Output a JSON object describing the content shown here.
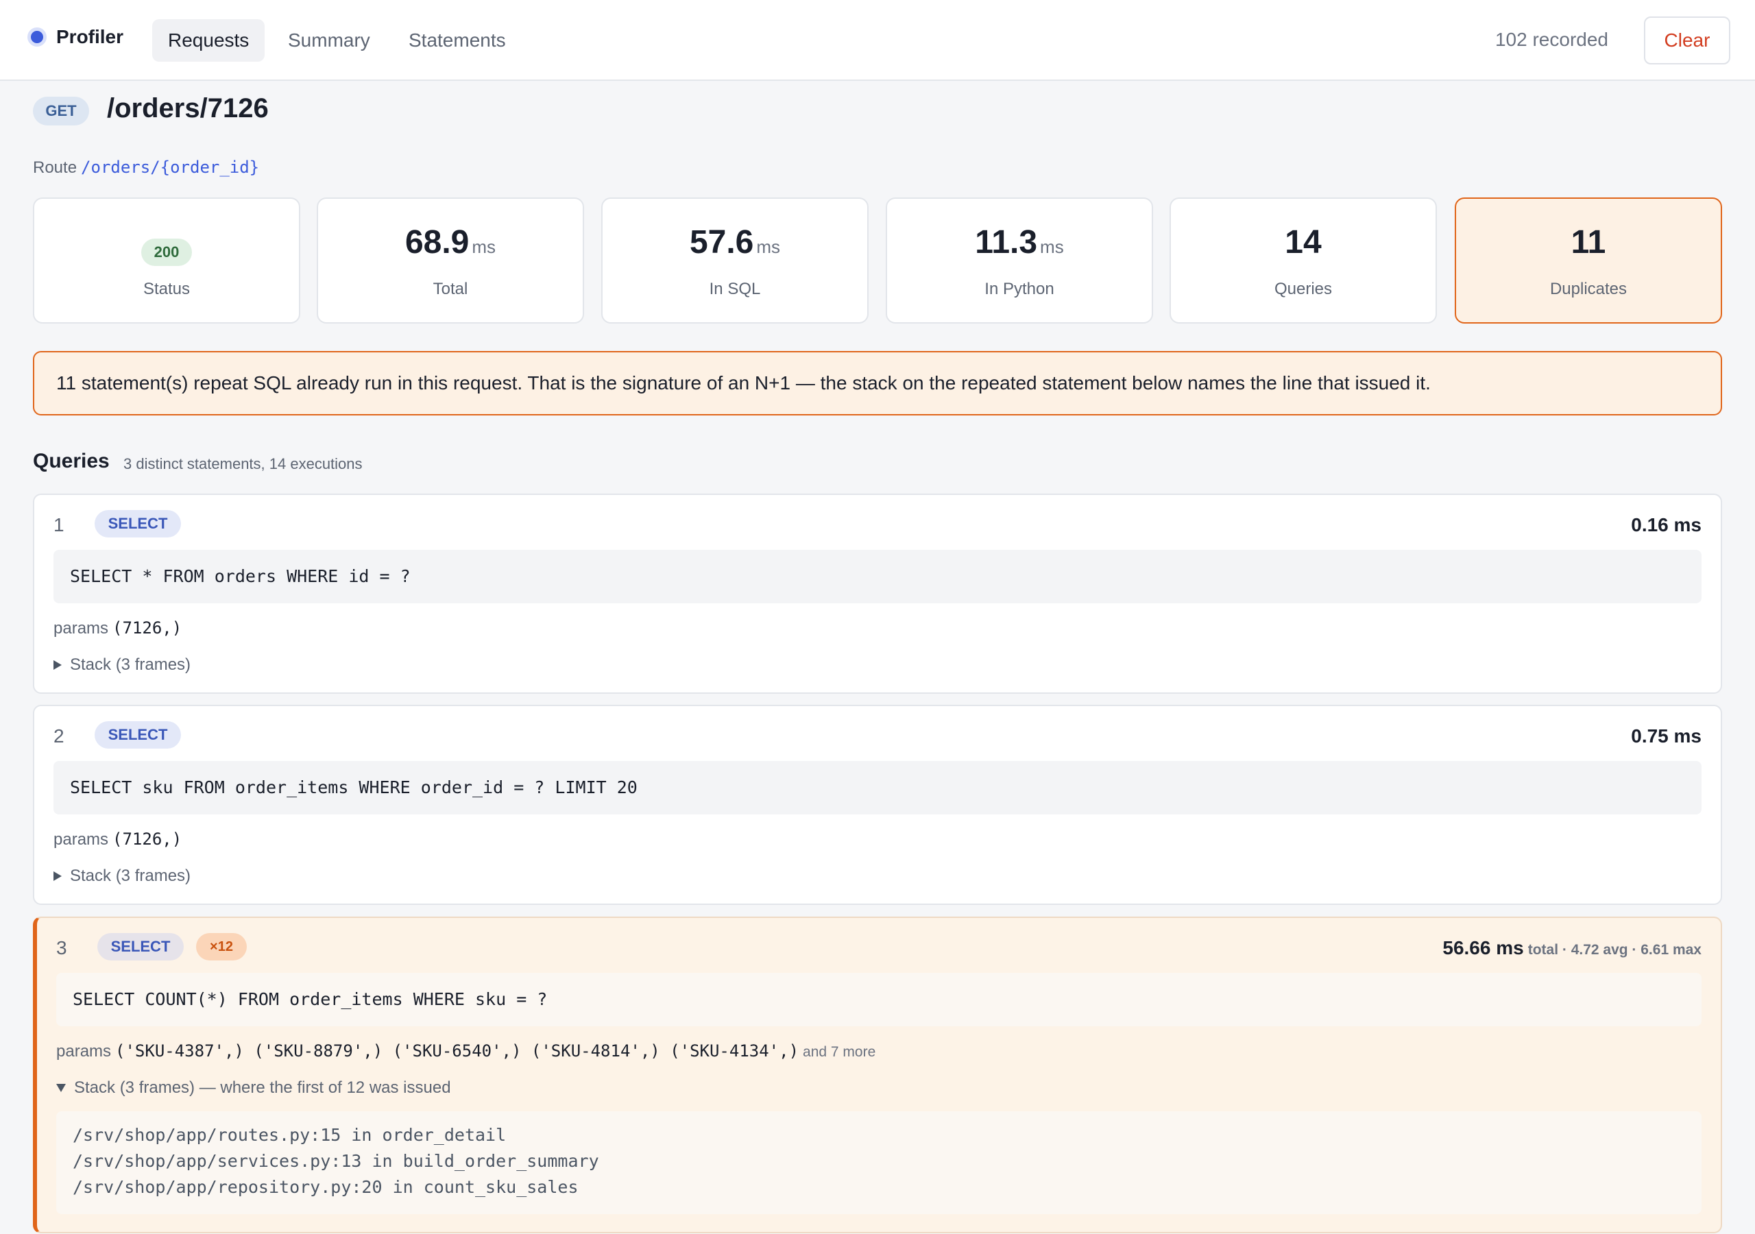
{
  "app": {
    "brand": "Profiler",
    "tabs": [
      {
        "label": "Requests",
        "active": true
      },
      {
        "label": "Summary",
        "active": false
      },
      {
        "label": "Statements",
        "active": false
      }
    ],
    "recorded": "102 recorded",
    "clear_label": "Clear"
  },
  "request": {
    "method": "GET",
    "path": "/orders/7126",
    "route_label": "Route",
    "route": "/orders/{order_id}"
  },
  "stats": [
    {
      "value": "200",
      "unit": "",
      "label": "Status"
    },
    {
      "value": "68.9",
      "unit": "ms",
      "label": "Total"
    },
    {
      "value": "57.6",
      "unit": "ms",
      "label": "In SQL"
    },
    {
      "value": "11.3",
      "unit": "ms",
      "label": "In Python"
    },
    {
      "value": "14",
      "unit": "",
      "label": "Queries"
    },
    {
      "value": "11",
      "unit": "",
      "label": "Duplicates"
    }
  ],
  "banner": "11 statement(s) repeat SQL already run in this request. That is the signature of an N+1 — the stack on the repeated statement below names the line that issued it.",
  "queries": {
    "title": "Queries",
    "subtitle": "3 distinct statements, 14 executions",
    "items": [
      {
        "index": "1",
        "kind": "SELECT",
        "time": "0.16 ms",
        "sql": "SELECT * FROM orders WHERE id = ?",
        "params_label": "params",
        "params": "(7126,)",
        "stack_label": "Stack (3 frames)"
      },
      {
        "index": "2",
        "kind": "SELECT",
        "time": "0.75 ms",
        "sql": "SELECT sku FROM order_items WHERE order_id = ? LIMIT 20",
        "params_label": "params",
        "params": "(7126,)",
        "stack_label": "Stack (3 frames)"
      },
      {
        "index": "3",
        "kind": "SELECT",
        "dup_count": "×12",
        "time": "56.66 ms",
        "time_extra": "total · 4.72 avg · 6.61 max",
        "sql": "SELECT COUNT(*) FROM order_items WHERE sku = ?",
        "params_label": "params",
        "params": "('SKU-4387',) ('SKU-8879',) ('SKU-6540',) ('SKU-4814',) ('SKU-4134',)",
        "params_more": "and 7 more",
        "stack_label": "Stack (3 frames) — where the first of 12 was issued",
        "frames": [
          "/srv/shop/app/routes.py:15 in order_detail",
          "/srv/shop/app/services.py:13 in build_order_summary",
          "/srv/shop/app/repository.py:20 in count_sku_sales"
        ]
      }
    ]
  },
  "colors": {
    "accent": "#3b5bdb",
    "warning": "#e0651a",
    "danger": "#d23c1f",
    "success": "#2f6b3c"
  }
}
